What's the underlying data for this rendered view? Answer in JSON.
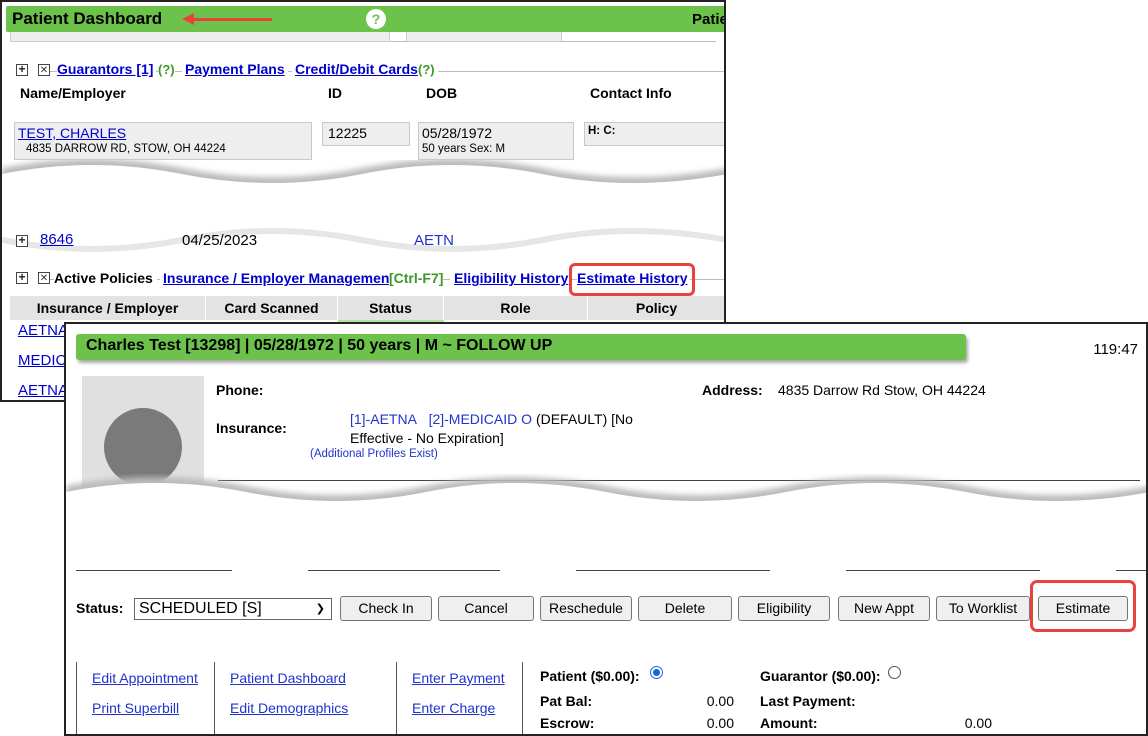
{
  "dashboard": {
    "title": "Patient Dashboard",
    "help_icon": "?",
    "right_cut_label": "Patie",
    "guarantor_section": {
      "link_guarantors": "Guarantors [1]",
      "help_1": "(?)",
      "link_payment_plans": "Payment Plans",
      "link_cards": "Credit/Debit Cards",
      "help_2": "(?)",
      "columns": [
        "Name/Employer",
        "ID",
        "DOB",
        "Contact Info"
      ],
      "row": {
        "name": "TEST, CHARLES",
        "address": "4835 DARROW RD, STOW, OH 44224",
        "id": "12225",
        "dob": "05/28/1972",
        "age_sex": "50 years  Sex: M",
        "contact": "H:   C:"
      }
    },
    "partial_row": {
      "id": "8646",
      "date": "04/25/2023",
      "ins": "AETN"
    },
    "policies_section": {
      "label": "Active Policies",
      "link_ins_mgmt": "Insurance / Employer Management",
      "shortcut": "[Ctrl-F7]",
      "link_eligibility": "Eligibility History",
      "link_estimate_history": "Estimate History",
      "columns": [
        "Insurance / Employer",
        "Card Scanned",
        "Status",
        "Role",
        "Policy"
      ],
      "rows": [
        "AETNA",
        "MEDIC",
        "AETNA"
      ]
    }
  },
  "appointment": {
    "title": "Charles Test [13298] | 05/28/1972 | 50 years | M  ~  FOLLOW UP",
    "timer": "119:47",
    "phone_label": "Phone:",
    "address_label": "Address:",
    "address_value": "4835 Darrow Rd Stow, OH 44224",
    "insurance_label": "Insurance:",
    "ins_1": "[1]-AETNA",
    "ins_2": "[2]-MEDICAID O",
    "ins_default": "(DEFAULT) [No",
    "ins_line2": "Effective - No Expiration]",
    "additional_profiles": "(Additional Profiles Exist)",
    "status_label": "Status:",
    "status_value": "SCHEDULED [S]",
    "buttons": {
      "check_in": "Check In",
      "cancel": "Cancel",
      "reschedule": "Reschedule",
      "delete": "Delete",
      "eligibility": "Eligibility",
      "new_appt": "New Appt",
      "to_worklist": "To Worklist",
      "estimate": "Estimate"
    },
    "links": {
      "edit_appointment": "Edit Appointment",
      "print_superbill": "Print Superbill",
      "patient_dashboard": "Patient Dashboard",
      "edit_demographics": "Edit Demographics",
      "enter_payment": "Enter Payment",
      "enter_charge": "Enter Charge"
    },
    "balances": {
      "patient_label": "Patient ($0.00):",
      "guarantor_label": "Guarantor ($0.00):",
      "pat_bal_label": "Pat Bal:",
      "pat_bal_value": "0.00",
      "escrow_label": "Escrow:",
      "escrow_value": "0.00",
      "last_payment_label": "Last Payment:",
      "amount_label": "Amount:",
      "amount_value": "0.00"
    }
  }
}
